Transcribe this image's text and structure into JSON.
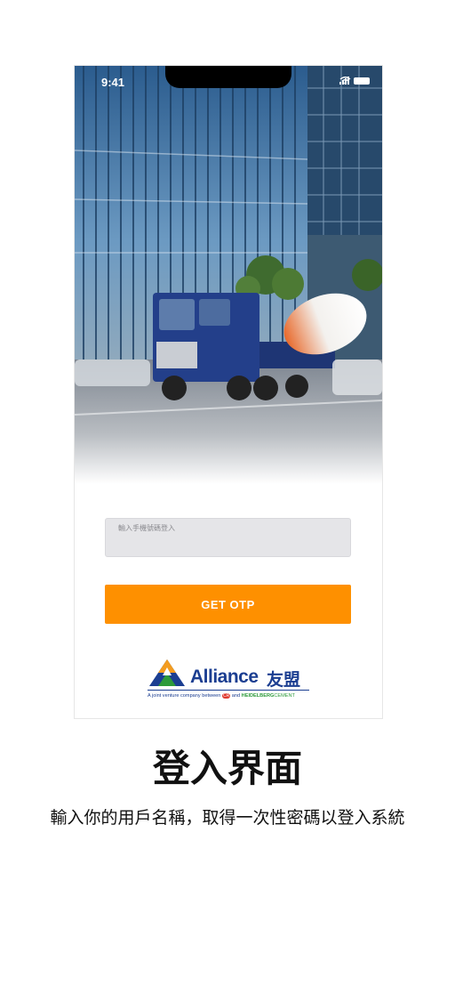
{
  "status_bar": {
    "time": "9:41"
  },
  "login": {
    "phone_placeholder": "輸入手機號碼登入",
    "otp_button_label": "GET OTP"
  },
  "logo": {
    "name_en": "Alliance",
    "name_zh": "友盟",
    "tagline_prefix": "A joint venture company between",
    "tagline_badge": "CR",
    "tagline_and": "and",
    "tagline_brand_bold": "HEIDELBERG",
    "tagline_brand_light": "CEMENT"
  },
  "caption": {
    "title": "登入界面",
    "description": "輸入你的用戶名稱，取得一次性密碼以登入系統"
  },
  "colors": {
    "accent": "#fe9000",
    "brand_blue": "#1b3e91",
    "brand_green": "#2d9a3a"
  }
}
